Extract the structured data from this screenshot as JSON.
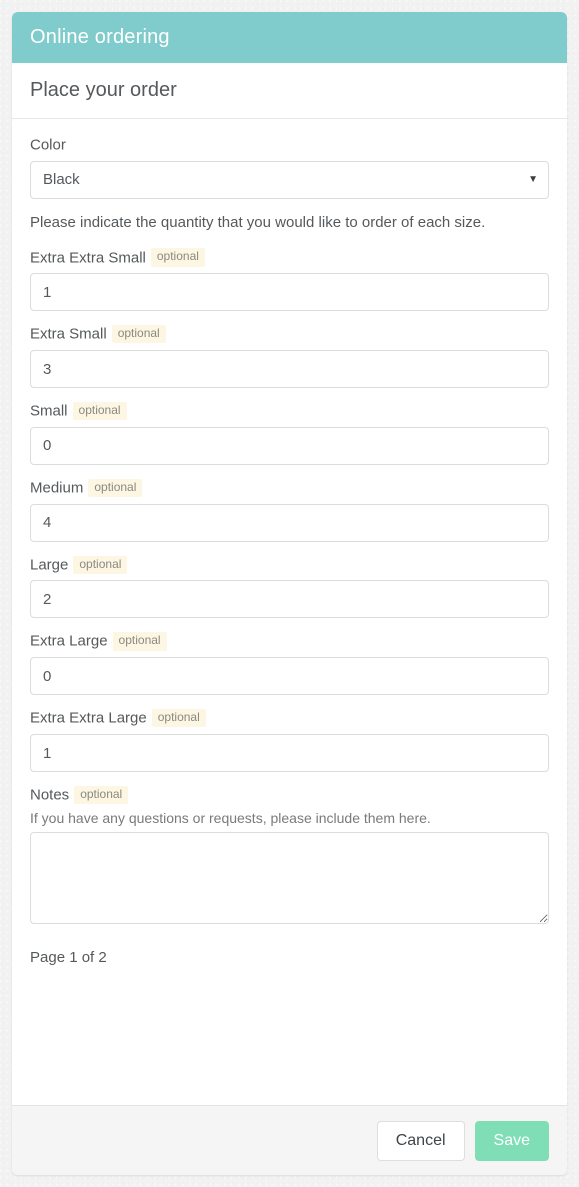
{
  "window": {
    "header_title": "Online ordering",
    "header_bg": "#80cccc"
  },
  "page": {
    "title": "Place your order",
    "instruction": "Please indicate the quantity that you would like to order of each size.",
    "page_indicator": "Page 1 of 2"
  },
  "color_field": {
    "label": "Color",
    "value": "Black",
    "caret_icon": "▼",
    "options": [
      "Black"
    ]
  },
  "optional_badge_label": "optional",
  "size_fields": [
    {
      "label": "Extra Extra Small",
      "badge": "optional",
      "value": "1"
    },
    {
      "label": "Extra Small",
      "badge": "optional",
      "value": "3"
    },
    {
      "label": "Small",
      "badge": "optional",
      "value": "0"
    },
    {
      "label": "Medium",
      "badge": "optional",
      "value": "4"
    },
    {
      "label": "Large",
      "badge": "optional",
      "value": "2"
    },
    {
      "label": "Extra Large",
      "badge": "optional",
      "value": "0"
    },
    {
      "label": "Extra Extra Large",
      "badge": "optional",
      "value": "1"
    }
  ],
  "notes_field": {
    "label": "Notes",
    "badge": "optional",
    "help": "If you have any questions or requests, please include them here.",
    "value": "",
    "placeholder": ""
  },
  "footer": {
    "cancel_label": "Cancel",
    "save_label": "Save",
    "save_color": "#80deb6"
  }
}
